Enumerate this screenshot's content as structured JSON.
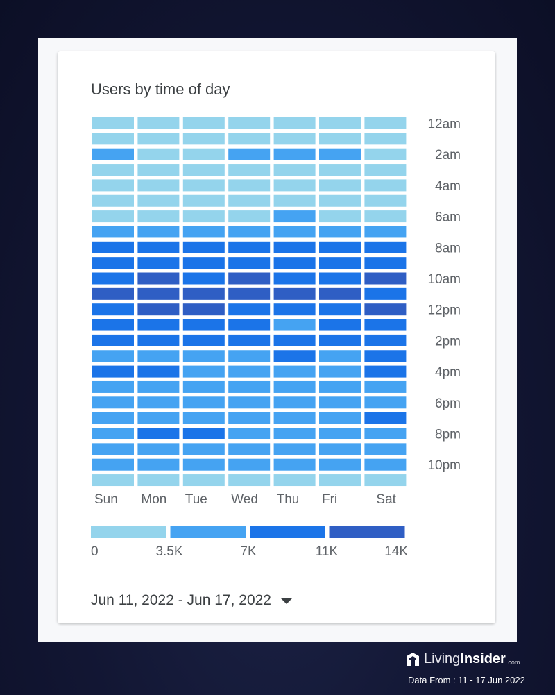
{
  "card": {
    "title": "Users by time of day",
    "date_range": "Jun 11, 2022 - Jun 17, 2022",
    "date_dropdown_icon": "caret-down-icon"
  },
  "branding": {
    "logo_icon": "house-logo-icon",
    "name_part1": "Living",
    "name_part2": "Insider",
    "suffix": ".com",
    "data_from": "Data From : 11 - 17 Jun 2022"
  },
  "chart_data": {
    "type": "heatmap",
    "title": "Users by time of day",
    "x": [
      "Sun",
      "Mon",
      "Tue",
      "Wed",
      "Thu",
      "Fri",
      "Sat"
    ],
    "y": [
      "12am",
      "1am",
      "2am",
      "3am",
      "4am",
      "5am",
      "6am",
      "7am",
      "8am",
      "9am",
      "10am",
      "11am",
      "12pm",
      "1pm",
      "2pm",
      "3pm",
      "4pm",
      "5pm",
      "6pm",
      "7pm",
      "8pm",
      "9pm",
      "10pm",
      "11pm"
    ],
    "y_tick_labels": [
      "12am",
      "2am",
      "4am",
      "6am",
      "8am",
      "10am",
      "12pm",
      "2pm",
      "4pm",
      "6pm",
      "8pm",
      "10pm"
    ],
    "value_note": "Values are color-bucket indices (1=0–3.5K, 2=3.5K–7K, 3=7K–11K, 4=11K–14K users)",
    "values": [
      [
        1,
        1,
        1,
        1,
        1,
        1,
        1
      ],
      [
        1,
        1,
        1,
        1,
        1,
        1,
        1
      ],
      [
        2,
        1,
        1,
        2,
        2,
        2,
        1
      ],
      [
        1,
        1,
        1,
        1,
        1,
        1,
        1
      ],
      [
        1,
        1,
        1,
        1,
        1,
        1,
        1
      ],
      [
        1,
        1,
        1,
        1,
        1,
        1,
        1
      ],
      [
        1,
        1,
        1,
        1,
        2,
        1,
        1
      ],
      [
        2,
        2,
        2,
        2,
        2,
        2,
        2
      ],
      [
        3,
        3,
        3,
        3,
        3,
        3,
        3
      ],
      [
        3,
        3,
        3,
        3,
        3,
        3,
        3
      ],
      [
        3,
        4,
        3,
        4,
        3,
        3,
        4
      ],
      [
        4,
        4,
        4,
        4,
        4,
        4,
        3
      ],
      [
        3,
        4,
        4,
        3,
        3,
        3,
        4
      ],
      [
        3,
        3,
        3,
        3,
        2,
        3,
        3
      ],
      [
        3,
        3,
        3,
        3,
        3,
        3,
        3
      ],
      [
        2,
        2,
        2,
        2,
        3,
        2,
        3
      ],
      [
        3,
        3,
        2,
        2,
        2,
        2,
        3
      ],
      [
        2,
        2,
        2,
        2,
        2,
        2,
        2
      ],
      [
        2,
        2,
        2,
        2,
        2,
        2,
        2
      ],
      [
        2,
        2,
        2,
        2,
        2,
        2,
        3
      ],
      [
        2,
        3,
        3,
        2,
        2,
        2,
        2
      ],
      [
        2,
        2,
        2,
        2,
        2,
        2,
        2
      ],
      [
        2,
        2,
        2,
        2,
        2,
        2,
        2
      ],
      [
        1,
        1,
        1,
        1,
        1,
        1,
        1
      ]
    ],
    "legend": {
      "bins": [
        {
          "range": "0 - 3.5K",
          "color": "#94d4ec"
        },
        {
          "range": "3.5K - 7K",
          "color": "#45a3f2"
        },
        {
          "range": "7K - 11K",
          "color": "#1b74e8"
        },
        {
          "range": "11K - 14K",
          "color": "#2f5ec4"
        }
      ],
      "tick_labels": [
        "0",
        "3.5K",
        "7K",
        "11K",
        "14K"
      ],
      "placement": "bottom"
    }
  }
}
